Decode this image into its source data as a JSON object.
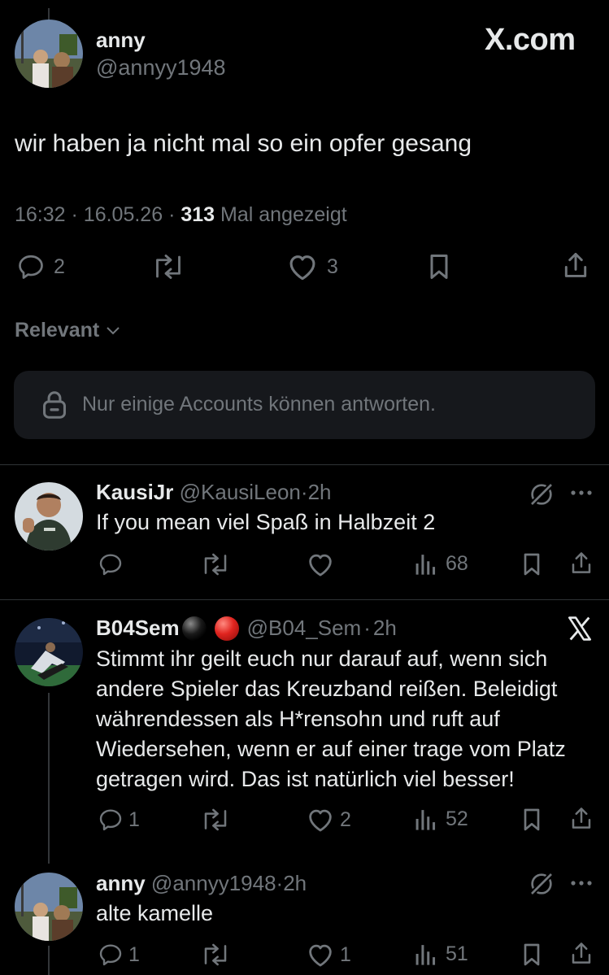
{
  "watermark": "X.com",
  "main_post": {
    "display_name": "anny",
    "handle": "@annyy1948",
    "text": "wir haben ja nicht mal so ein opfer gesang",
    "time": "16:32",
    "date": "16.05.26",
    "views_count": "313",
    "views_label": "Mal angezeigt",
    "reply_count": "2",
    "like_count": "3"
  },
  "sort": {
    "label": "Relevant"
  },
  "reply_restriction": {
    "text": "Nur einige Accounts können antworten."
  },
  "replies": [
    {
      "display_name": "KausiJr",
      "handle": "@KausiLeon",
      "time": "2h",
      "text": "If you mean viel Spaß in Halbzeit 2",
      "views": "68"
    },
    {
      "display_name": "B04Sem",
      "handle": "@B04_Sem",
      "time": "2h",
      "text_lines": [
        "Stimmt ihr geilt euch nur darauf auf, wenn sich",
        "andere Spieler das Kreuzband reißen. Beleidigt",
        "währendessen als H*rensohn und ruft auf",
        "Wiedersehen, wenn er auf einer trage vom Platz",
        "getragen wird. Das ist natürlich viel besser!"
      ],
      "reply_count": "1",
      "like_count": "2",
      "views": "52"
    },
    {
      "display_name": "anny",
      "handle": "@annyy1948",
      "time": "2h",
      "text": "alte kamelle",
      "reply_count": "1",
      "like_count": "1",
      "views": "51"
    }
  ],
  "separator": "·",
  "colors": {
    "background": "#000000",
    "text": "#e7e9ea",
    "muted": "#71767b",
    "card": "#16181c",
    "red_circle": "#e0241f"
  }
}
